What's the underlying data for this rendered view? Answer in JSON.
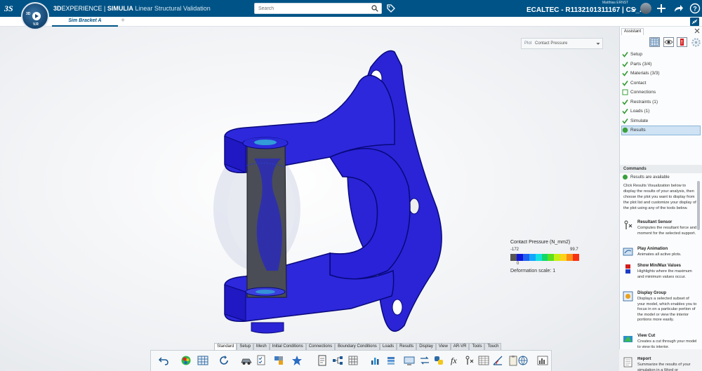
{
  "app": {
    "brand_bold": "3D",
    "brand_mid": "EXPERIENCE",
    "brand_sep": " | ",
    "brand_app": "SIMULIA",
    "brand_role": " Linear Structural Validation",
    "compass_version": "V.R",
    "compass_3d": "3D"
  },
  "search": {
    "placeholder": "Search"
  },
  "user": {
    "name": "Matthias ERNST",
    "tenant": "ECALTEC - R1132101311167 | CS_..."
  },
  "tabs": {
    "active": "Sim Bracket A",
    "add": "+"
  },
  "plot": {
    "label": "Plot",
    "value": "Contact Pressure"
  },
  "legend": {
    "title": "Contact Pressure (N_mm2)",
    "min": "-172",
    "max": "99.7",
    "zero": "0",
    "deformation": "Deformation scale: 1",
    "colors": [
      "#555555",
      "#1016d8",
      "#1e60f0",
      "#12a5ff",
      "#15e0e0",
      "#12d86a",
      "#5ce01c",
      "#c6ee14",
      "#ffd21a",
      "#ff8d15",
      "#f83012"
    ]
  },
  "assistant": {
    "tab": "Assistant",
    "steps": [
      {
        "label": "Setup",
        "status": "done"
      },
      {
        "label": "Parts (3/4)",
        "status": "done"
      },
      {
        "label": "Materials (3/3)",
        "status": "done"
      },
      {
        "label": "Contact",
        "status": "done"
      },
      {
        "label": "Connections",
        "status": "todo"
      },
      {
        "label": "Restraints (1)",
        "status": "done"
      },
      {
        "label": "Loads (1)",
        "status": "done"
      },
      {
        "label": "Simulate",
        "status": "done"
      },
      {
        "label": "Results",
        "status": "active"
      }
    ],
    "commands_title": "Commands",
    "results_available": "Results are available",
    "intro": "Click Results Visualization below to display the results of your analysis, then choose the plot you want to display from the plot list and customize your display of the plot using any of the tools below.",
    "commands": [
      {
        "title": "Resultant Sensor",
        "desc": "Computes the resultant force and moment for the selected support."
      },
      {
        "title": "Play Animation",
        "desc": "Animates all active plots."
      },
      {
        "title": "Show Min/Max Values",
        "desc": "Highlights where the maximum and minimum values occur."
      },
      {
        "title": "Display Group",
        "desc": "Displays a selected subset of your model, which enables you to focus in on a particular portion of the model or view the interior portions more easily."
      },
      {
        "title": "View Cut",
        "desc": "Creates a cut through your model to view its interior."
      },
      {
        "title": "Report",
        "desc": "Summarize the results of your simulation in a Word or Powerpoint file. You can"
      }
    ]
  },
  "bottom_tabs": [
    "Standard",
    "Setup",
    "Mesh",
    "Initial Conditions",
    "Connections",
    "Boundary Conditions",
    "Loads",
    "Results",
    "Display",
    "View",
    "AR-VR",
    "Tools",
    "Touch"
  ],
  "colors": {
    "brand_blue": "#005386",
    "model_blue": "#2222d4",
    "pin_gray": "#4a4d55"
  }
}
